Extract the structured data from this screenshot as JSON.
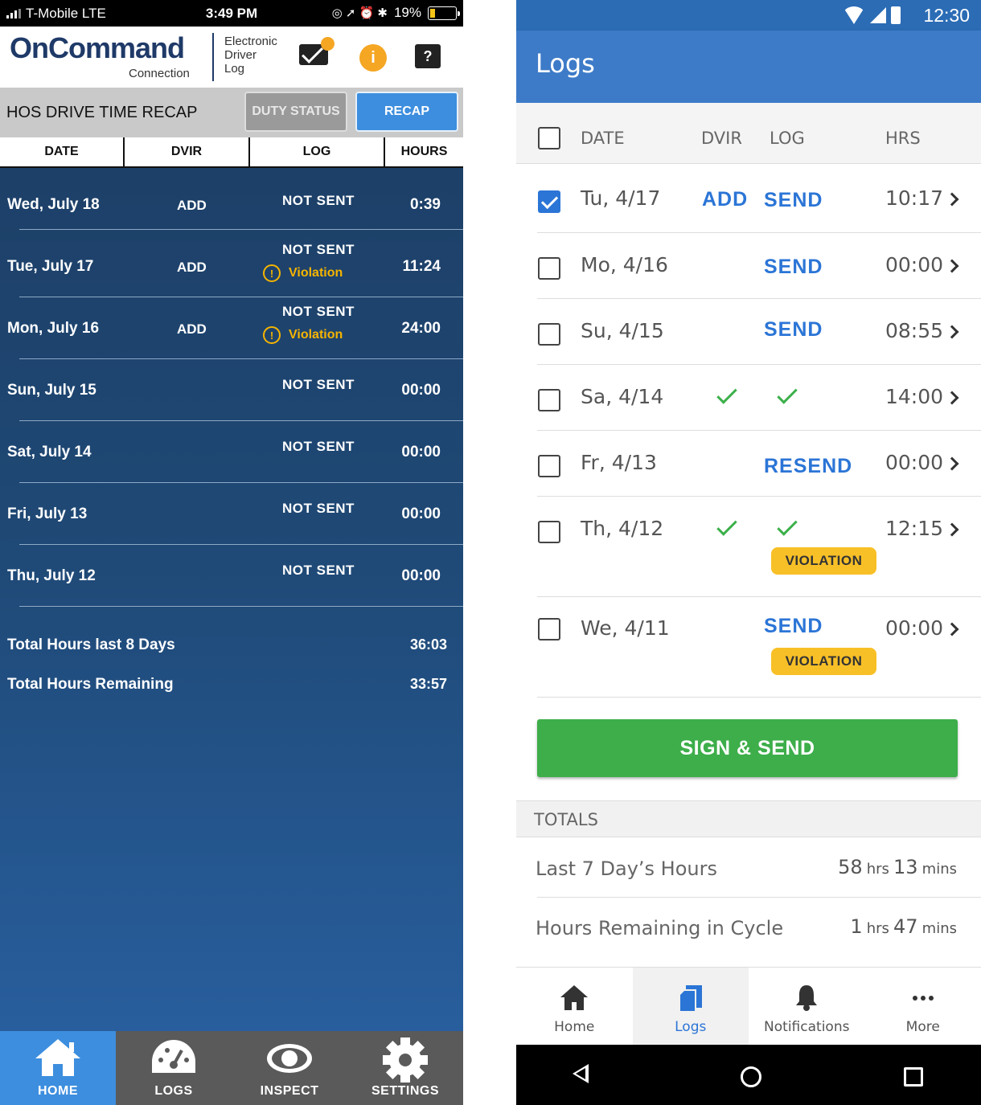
{
  "left": {
    "status": {
      "carrier": "T-Mobile  LTE",
      "time": "3:49 PM",
      "battery": "19%"
    },
    "brand": {
      "name": "OnCommand",
      "sub": "Connection",
      "edl": [
        "Electronic",
        "Driver",
        "Log"
      ]
    },
    "recap": {
      "title": "HOS DRIVE TIME RECAP",
      "duty_btn": "DUTY STATUS",
      "recap_btn": "RECAP"
    },
    "columns": [
      "DATE",
      "DVIR",
      "LOG",
      "HOURS"
    ],
    "rows": [
      {
        "date": "Wed, July 18",
        "dvir": "ADD",
        "log": "NOT SENT",
        "violation": "",
        "hours": "0:39"
      },
      {
        "date": "Tue, July 17",
        "dvir": "ADD",
        "log": "NOT SENT",
        "violation": "Violation",
        "hours": "11:24"
      },
      {
        "date": "Mon, July 16",
        "dvir": "ADD",
        "log": "NOT SENT",
        "violation": "Violation",
        "hours": "24:00"
      },
      {
        "date": "Sun, July 15",
        "dvir": "",
        "log": "NOT SENT",
        "violation": "",
        "hours": "00:00"
      },
      {
        "date": "Sat, July 14",
        "dvir": "",
        "log": "NOT SENT",
        "violation": "",
        "hours": "00:00"
      },
      {
        "date": "Fri, July 13",
        "dvir": "",
        "log": "NOT SENT",
        "violation": "",
        "hours": "00:00"
      },
      {
        "date": "Thu, July 12",
        "dvir": "",
        "log": "NOT SENT",
        "violation": "",
        "hours": "00:00"
      }
    ],
    "totals": [
      {
        "label": "Total Hours last 8 Days",
        "value": "36:03"
      },
      {
        "label": "Total Hours Remaining",
        "value": "33:57"
      }
    ],
    "tabs": [
      {
        "label": "HOME",
        "icon": "home-icon",
        "active": true
      },
      {
        "label": "LOGS",
        "icon": "gauge-icon",
        "active": false
      },
      {
        "label": "INSPECT",
        "icon": "eye-icon",
        "active": false
      },
      {
        "label": "SETTINGS",
        "icon": "gear-icon",
        "active": false
      }
    ],
    "colors": {
      "accent": "#3d8ede",
      "violation": "#f5b400",
      "bg": "#1f4976"
    }
  },
  "right": {
    "status": {
      "time": "12:30"
    },
    "title": "Logs",
    "columns": [
      "DATE",
      "DVIR",
      "LOG",
      "HRS"
    ],
    "rows": [
      {
        "date": "Tu, 4/17",
        "checked": true,
        "dvir": "ADD",
        "log": "SEND",
        "hrs": "10:17",
        "violation": ""
      },
      {
        "date": "Mo, 4/16",
        "checked": false,
        "dvir": "",
        "log": "SEND",
        "hrs": "00:00",
        "violation": ""
      },
      {
        "date": "Su, 4/15",
        "checked": false,
        "dvir": "",
        "log": "SEND",
        "hrs": "08:55",
        "violation": ""
      },
      {
        "date": "Sa, 4/14",
        "checked": false,
        "dvir": "check",
        "log": "check",
        "hrs": "14:00",
        "violation": ""
      },
      {
        "date": "Fr, 4/13",
        "checked": false,
        "dvir": "",
        "log": "RESEND",
        "hrs": "00:00",
        "violation": ""
      },
      {
        "date": "Th, 4/12",
        "checked": false,
        "dvir": "check",
        "log": "check",
        "hrs": "12:15",
        "violation": "VIOLATION"
      },
      {
        "date": "We, 4/11",
        "checked": false,
        "dvir": "",
        "log": "SEND",
        "hrs": "00:00",
        "violation": "VIOLATION"
      }
    ],
    "sign_send": "SIGN & SEND",
    "totals_header": "TOTALS",
    "totals": [
      {
        "label": "Last 7 Day’s Hours",
        "h": "58",
        "h_unit": "hrs",
        "m": "13",
        "m_unit": "mins"
      },
      {
        "label": "Hours Remaining in Cycle",
        "h": "1",
        "h_unit": "hrs",
        "m": "47",
        "m_unit": "mins"
      }
    ],
    "nav": [
      {
        "label": "Home",
        "icon": "home-icon",
        "active": false
      },
      {
        "label": "Logs",
        "icon": "logs-icon",
        "active": true
      },
      {
        "label": "Notifications",
        "icon": "bell-icon",
        "active": false
      },
      {
        "label": "More",
        "icon": "more-icon",
        "active": false
      }
    ],
    "colors": {
      "appbar": "#3d7bc8",
      "link": "#2b75d6",
      "check": "#3cb04a",
      "violation": "#f8c027",
      "button": "#3dae4a"
    }
  }
}
